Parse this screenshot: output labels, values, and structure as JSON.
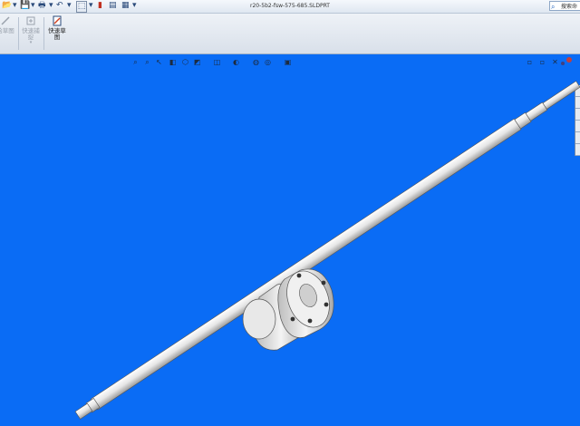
{
  "window": {
    "title": "r20-5b2-fsw-575-685.SLDPRT",
    "search_label": "搜索命"
  },
  "quick_access": [
    {
      "name": "open-icon",
      "glyph": "📂"
    },
    {
      "name": "save-icon",
      "glyph": "💾"
    },
    {
      "name": "print-icon",
      "glyph": "🖶"
    },
    {
      "name": "undo-icon",
      "glyph": "↶"
    },
    {
      "name": "select-icon",
      "glyph": "⬚"
    },
    {
      "name": "rebuild-icon",
      "glyph": "▮"
    },
    {
      "name": "file-properties-icon",
      "glyph": "▤"
    },
    {
      "name": "options-icon",
      "glyph": "▦"
    }
  ],
  "ribbon": {
    "sketch_label_1": "绘草图",
    "sketch_label_2": "快速捕\n捉",
    "quick_sketch_label": "快速草\n图"
  },
  "colors": {
    "viewport_bg": "#0a6cf5",
    "model": "#e8e8e8"
  },
  "heads_up_toolbar": [
    "zoom-to-fit-icon",
    "zoom-area-icon",
    "previous-view-icon",
    "section-view-icon",
    "view-orientation-icon",
    "display-style-icon",
    "hide-show-icon",
    "edit-appearance-icon",
    "apply-scene-icon",
    "view-settings-icon"
  ]
}
